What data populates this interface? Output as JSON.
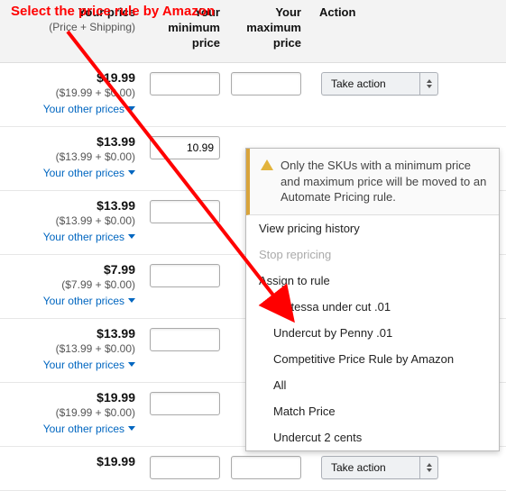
{
  "annotation": "Select the price\nrule by Amazon",
  "headers": {
    "your_price": "Your price",
    "your_price_sub": "(Price + Shipping)",
    "min": "Your minimum price",
    "max": "Your maximum price",
    "action": "Action"
  },
  "other_prices_label": "Your other prices",
  "take_action_label": "Take action",
  "currency_symbol": "$",
  "rows": [
    {
      "price": "$19.99",
      "breakdown": "($19.99 + $0.00)",
      "min": "",
      "max": ""
    },
    {
      "price": "$13.99",
      "breakdown": "($13.99 + $0.00)",
      "min": "10.99",
      "max": ""
    },
    {
      "price": "$13.99",
      "breakdown": "($13.99 + $0.00)",
      "min": "",
      "max": ""
    },
    {
      "price": "$7.99",
      "breakdown": "($7.99 + $0.00)",
      "min": "",
      "max": ""
    },
    {
      "price": "$13.99",
      "breakdown": "($13.99 + $0.00)",
      "min": "",
      "max": ""
    },
    {
      "price": "$19.99",
      "breakdown": "($19.99 + $0.00)",
      "min": "",
      "max": ""
    },
    {
      "price": "$19.99",
      "breakdown": "",
      "min": "",
      "max": ""
    }
  ],
  "dropdown": {
    "warning": "Only the SKUs with a minimum price and maximum price will be moved to an Automate Pricing rule.",
    "items": [
      {
        "label": "View pricing history",
        "disabled": false,
        "sub": false
      },
      {
        "label": "Stop repricing",
        "disabled": true,
        "sub": false
      },
      {
        "label": "Assign to rule",
        "disabled": false,
        "sub": false
      },
      {
        "label": "Fortessa under cut .01",
        "disabled": false,
        "sub": true
      },
      {
        "label": "Undercut by Penny .01",
        "disabled": false,
        "sub": true
      },
      {
        "label": "Competitive Price Rule by Amazon",
        "disabled": false,
        "sub": true
      },
      {
        "label": "All",
        "disabled": false,
        "sub": true
      },
      {
        "label": "Match Price",
        "disabled": false,
        "sub": true
      },
      {
        "label": "Undercut 2 cents",
        "disabled": false,
        "sub": true
      }
    ]
  }
}
